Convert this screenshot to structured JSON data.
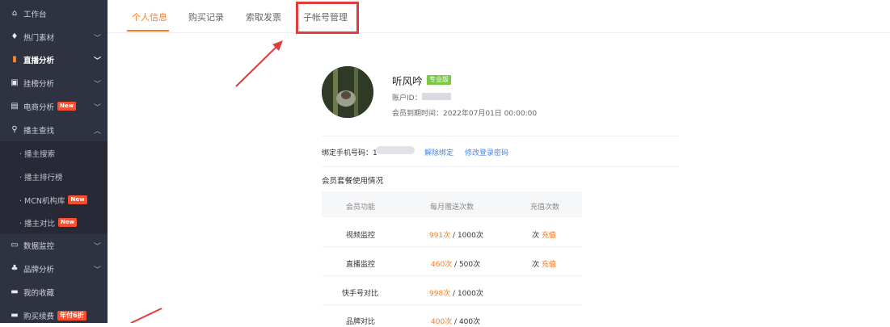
{
  "sidebar": {
    "items": [
      {
        "label": "工作台",
        "icon": "home-icon",
        "glyph": "⌂"
      },
      {
        "label": "热门素材",
        "icon": "flame-icon",
        "glyph": "♦"
      },
      {
        "label": "直播分析",
        "icon": "bar-chart-icon",
        "glyph": "▮"
      },
      {
        "label": "挂榜分析",
        "icon": "image-icon",
        "glyph": "▣"
      },
      {
        "label": "电商分析",
        "icon": "bag-icon",
        "glyph": "▤",
        "badge": "New"
      },
      {
        "label": "播主查找",
        "icon": "search-icon",
        "glyph": "⚲"
      },
      {
        "label": "数据监控",
        "icon": "monitor-icon",
        "glyph": "▭"
      },
      {
        "label": "品牌分析",
        "icon": "brand-icon",
        "glyph": "♣"
      },
      {
        "label": "我的收藏",
        "icon": "folder-icon",
        "glyph": "▬"
      },
      {
        "label": "购买续费",
        "icon": "card-icon",
        "glyph": "▬",
        "badge": "年付6折"
      }
    ],
    "subitems": [
      {
        "label": "· 播主搜索"
      },
      {
        "label": "· 播主排行榜"
      },
      {
        "label": "· MCN机构库",
        "badge": "New"
      },
      {
        "label": "· 播主对比",
        "badge": "New"
      }
    ]
  },
  "tabs": [
    {
      "label": "个人信息"
    },
    {
      "label": "购买记录"
    },
    {
      "label": "索取发票"
    },
    {
      "label": "子帐号管理"
    }
  ],
  "profile": {
    "nickname": "听风吟",
    "level_badge": "专业版",
    "account_id_label": "账户ID：",
    "expire_text": "会员到期时间：2022年07月01日 00:00:00",
    "phone_label": "绑定手机号码：1",
    "unbind_link": "解除绑定",
    "change_password_link": "修改登录密码"
  },
  "package": {
    "title": "会员套餐使用情况",
    "columns": [
      "会员功能",
      "每月赠送次数",
      "充值次数"
    ],
    "rows": [
      {
        "feature": "视频监控",
        "used": "991次",
        "total": " / 1000次",
        "recharge": "次",
        "recharge_link": "充值"
      },
      {
        "feature": "直播监控",
        "used": "460次",
        "total": " / 500次",
        "recharge": "次",
        "recharge_link": "充值"
      },
      {
        "feature": "快手号对比",
        "used": "998次",
        "total": " / 1000次",
        "recharge": "",
        "recharge_link": ""
      },
      {
        "feature": "品牌对比",
        "used": "400次",
        "total": " / 400次",
        "recharge": "",
        "recharge_link": ""
      }
    ]
  },
  "colors": {
    "accent": "#ff7a1a",
    "sidebar_bg": "#2f3341",
    "highlight": "#e13b3b",
    "link": "#4a84e0"
  }
}
